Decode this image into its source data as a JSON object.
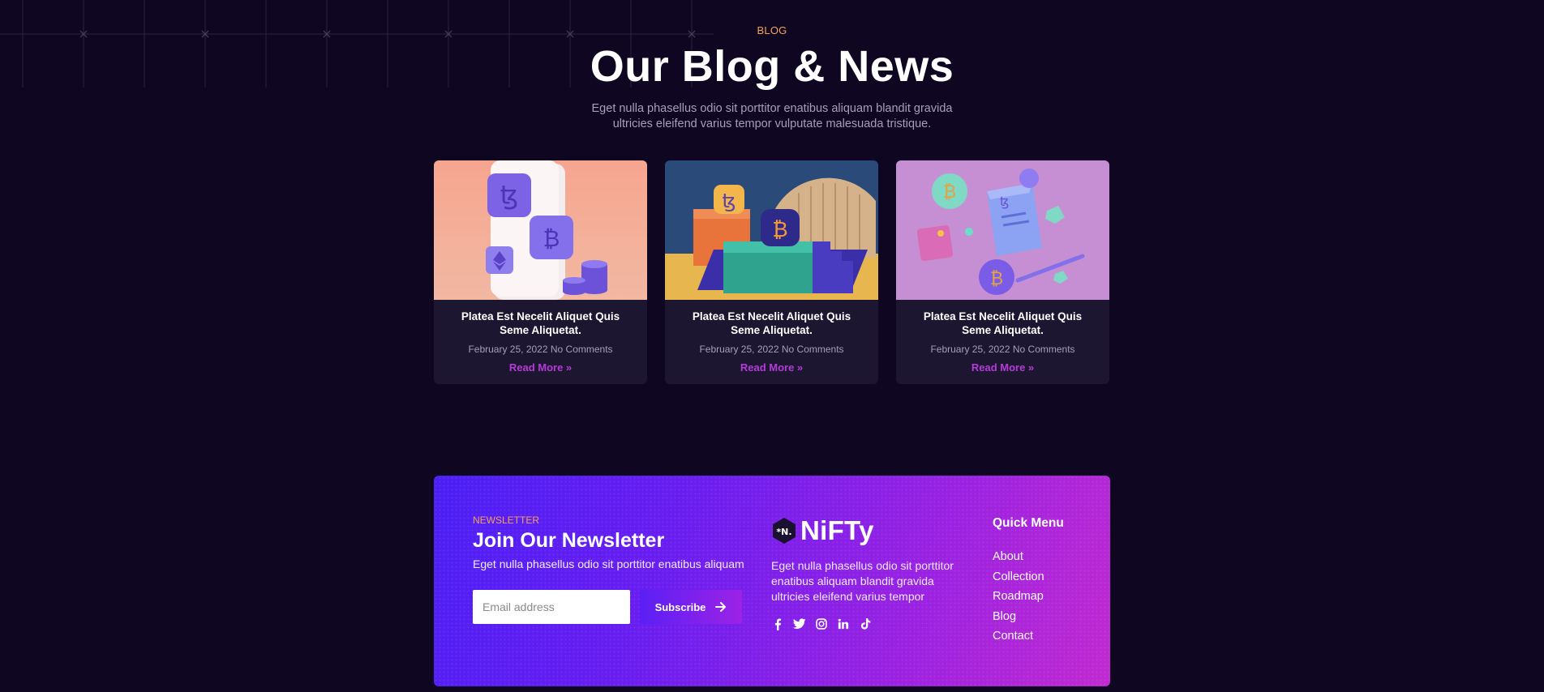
{
  "blog": {
    "eyebrow": "BLOG",
    "title": "Our Blog & News",
    "subtitle": "Eget nulla phasellus odio sit porttitor enatibus aliquam blandit gravida ultricies eleifend varius tempor vulputate malesuada tristique.",
    "posts": [
      {
        "title": "Platea Est Necelit Aliquet Quis Seme Aliquetat.",
        "date": "February 25, 2022",
        "comments": "No Comments",
        "link": "Read More »"
      },
      {
        "title": "Platea Est Necelit Aliquet Quis Seme Aliquetat.",
        "date": "February 25, 2022",
        "comments": "No Comments",
        "link": "Read More »"
      },
      {
        "title": "Platea Est Necelit Aliquet Quis Seme Aliquetat.",
        "date": "February 25, 2022",
        "comments": "No Comments",
        "link": "Read More »"
      }
    ]
  },
  "newsletter": {
    "eyebrow": "NEWSLETTER",
    "title": "Join Our Newsletter",
    "subtitle": "Eget nulla phasellus odio sit porttitor enatibus aliquam",
    "email_placeholder": "Email address",
    "subscribe_label": "Subscribe"
  },
  "brand": {
    "logo_mark": "*N.",
    "name": "NiFTy",
    "description": "Eget nulla phasellus odio sit porttitor enatibus aliquam blandit gravida ultricies eleifend varius tempor",
    "socials": [
      "facebook-icon",
      "twitter-icon",
      "instagram-icon",
      "linkedin-icon",
      "tiktok-icon"
    ]
  },
  "quick_menu": {
    "title": "Quick Menu",
    "items": [
      "About",
      "Collection",
      "Roadmap",
      "Blog",
      "Contact"
    ]
  },
  "colors": {
    "background": "#0f0722",
    "accent_orange": "#f5a15b",
    "link_purple": "#b53bd9",
    "card_bg": "#1d1630"
  }
}
